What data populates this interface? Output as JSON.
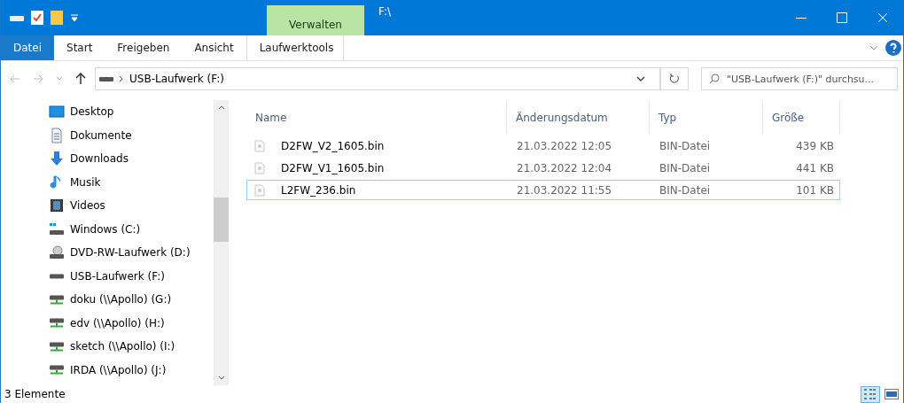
{
  "title_bar": {
    "context_tab": "Verwalten",
    "title": "F:\\"
  },
  "ribbon_tabs": [
    {
      "label": "Datei",
      "kind": "file",
      "selected": false
    },
    {
      "label": "Start",
      "kind": "tab",
      "selected": false
    },
    {
      "label": "Freigeben",
      "kind": "tab",
      "selected": false
    },
    {
      "label": "Ansicht",
      "kind": "tab",
      "selected": false
    },
    {
      "label": "Laufwerktools",
      "kind": "context",
      "selected": false
    }
  ],
  "address_bar": {
    "path": "USB-Laufwerk (F:)"
  },
  "search": {
    "placeholder": "\"USB-Laufwerk (F:)\" durchsu..."
  },
  "navigation": [
    {
      "label": "Desktop",
      "kind": "desktop"
    },
    {
      "label": "Dokumente",
      "kind": "documents"
    },
    {
      "label": "Downloads",
      "kind": "downloads"
    },
    {
      "label": "Musik",
      "kind": "music"
    },
    {
      "label": "Videos",
      "kind": "videos"
    },
    {
      "label": "Windows (C:)",
      "kind": "system-drive"
    },
    {
      "label": "DVD-RW-Laufwerk (D:)",
      "kind": "dvd-drive"
    },
    {
      "label": "USB-Laufwerk (F:)",
      "kind": "usb-drive"
    },
    {
      "label": "doku (\\\\Apollo) (G:)",
      "kind": "network-drive"
    },
    {
      "label": "edv (\\\\Apollo) (H:)",
      "kind": "network-drive"
    },
    {
      "label": "sketch (\\\\Apollo) (I:)",
      "kind": "network-drive"
    },
    {
      "label": "IRDA (\\\\Apollo) (J:)",
      "kind": "network-drive"
    }
  ],
  "table": {
    "columns": [
      "Name",
      "Änderungsdatum",
      "Typ",
      "Größe"
    ],
    "rows": [
      {
        "name": "D2FW_V2_1605.bin",
        "modified": "21.03.2022 12:05",
        "type": "BIN-Datei",
        "size": "439 KB",
        "focused": false
      },
      {
        "name": "D2FW_V1_1605.bin",
        "modified": "21.03.2022 12:04",
        "type": "BIN-Datei",
        "size": "441 KB",
        "focused": false
      },
      {
        "name": "L2FW_236.bin",
        "modified": "21.03.2022 11:55",
        "type": "BIN-Datei",
        "size": "101 KB",
        "focused": true
      }
    ]
  },
  "status_bar": {
    "count": "3 Elemente",
    "views": [
      {
        "kind": "details",
        "selected": true
      },
      {
        "kind": "tiles",
        "selected": false
      }
    ]
  }
}
